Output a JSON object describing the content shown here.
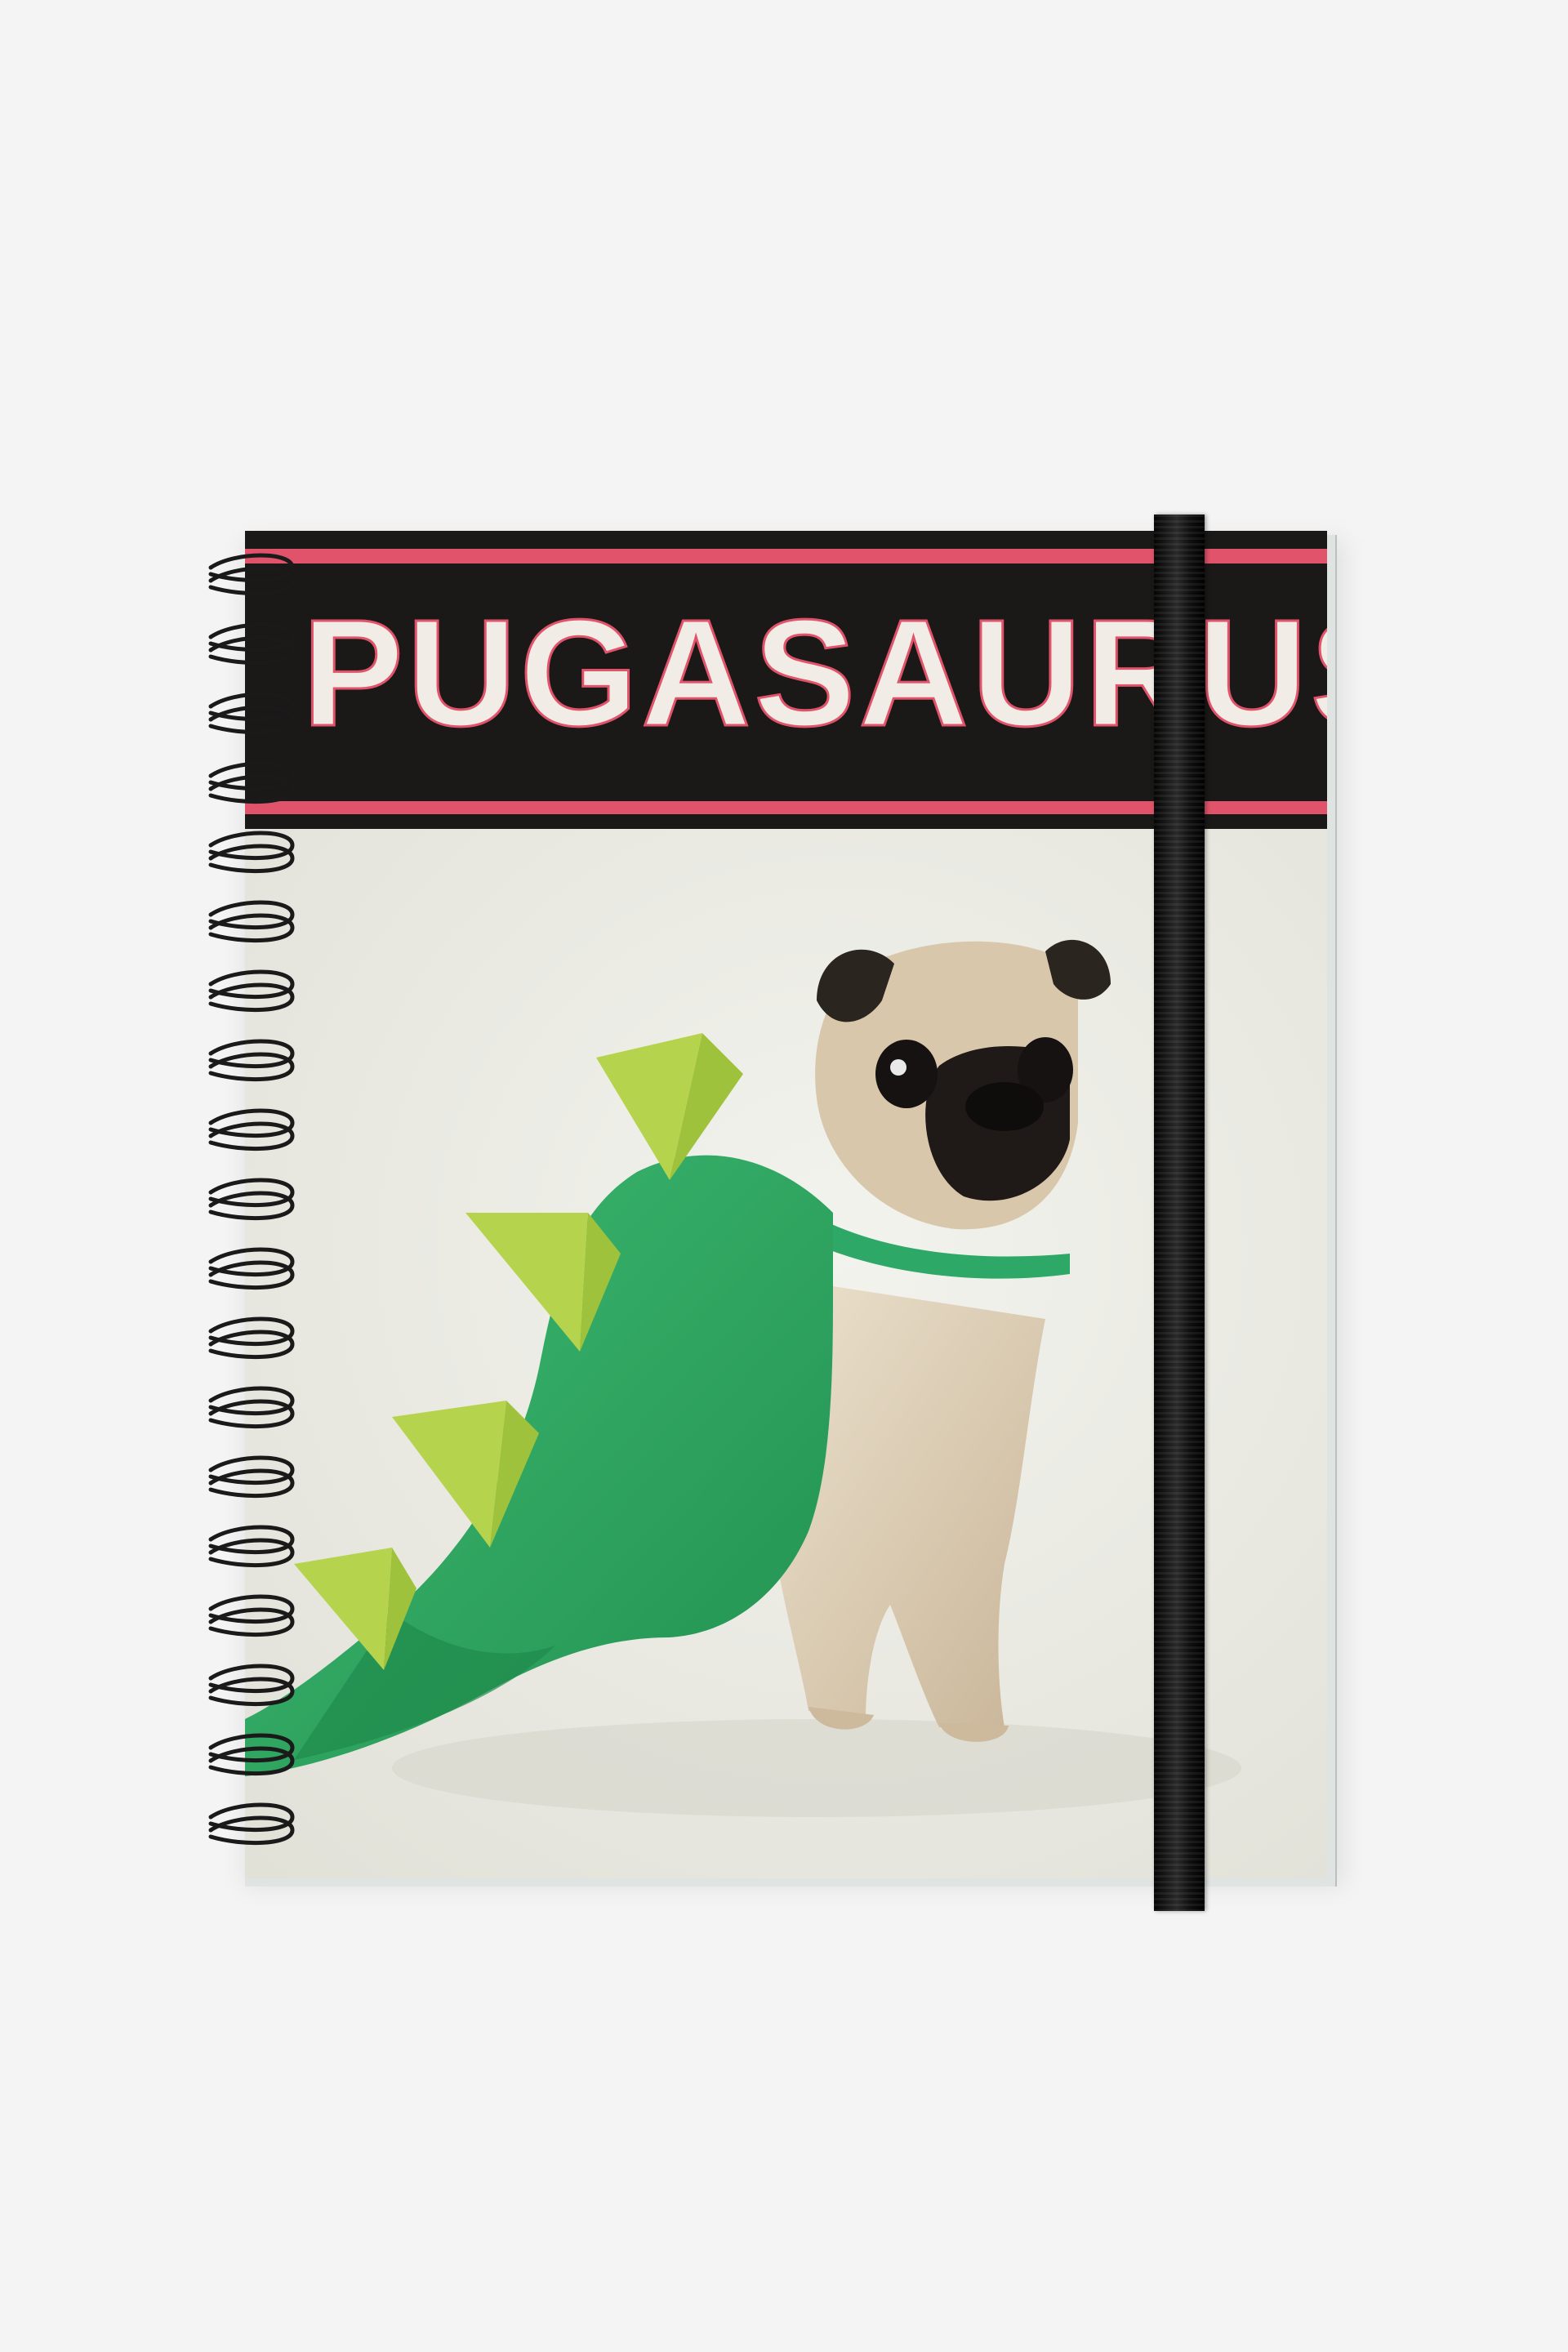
{
  "product": {
    "title": "PUGASAURUS"
  },
  "colors": {
    "background": "#f4f4f4",
    "band": "#1b1818",
    "accent_pink": "#e0536a",
    "costume_green": "#2ea866",
    "spike_green": "#b6d34e",
    "pug_fawn": "#d9c7ab",
    "elastic": "#111111"
  },
  "icons": [
    "spiral-binding-icon",
    "elastic-band-icon"
  ]
}
